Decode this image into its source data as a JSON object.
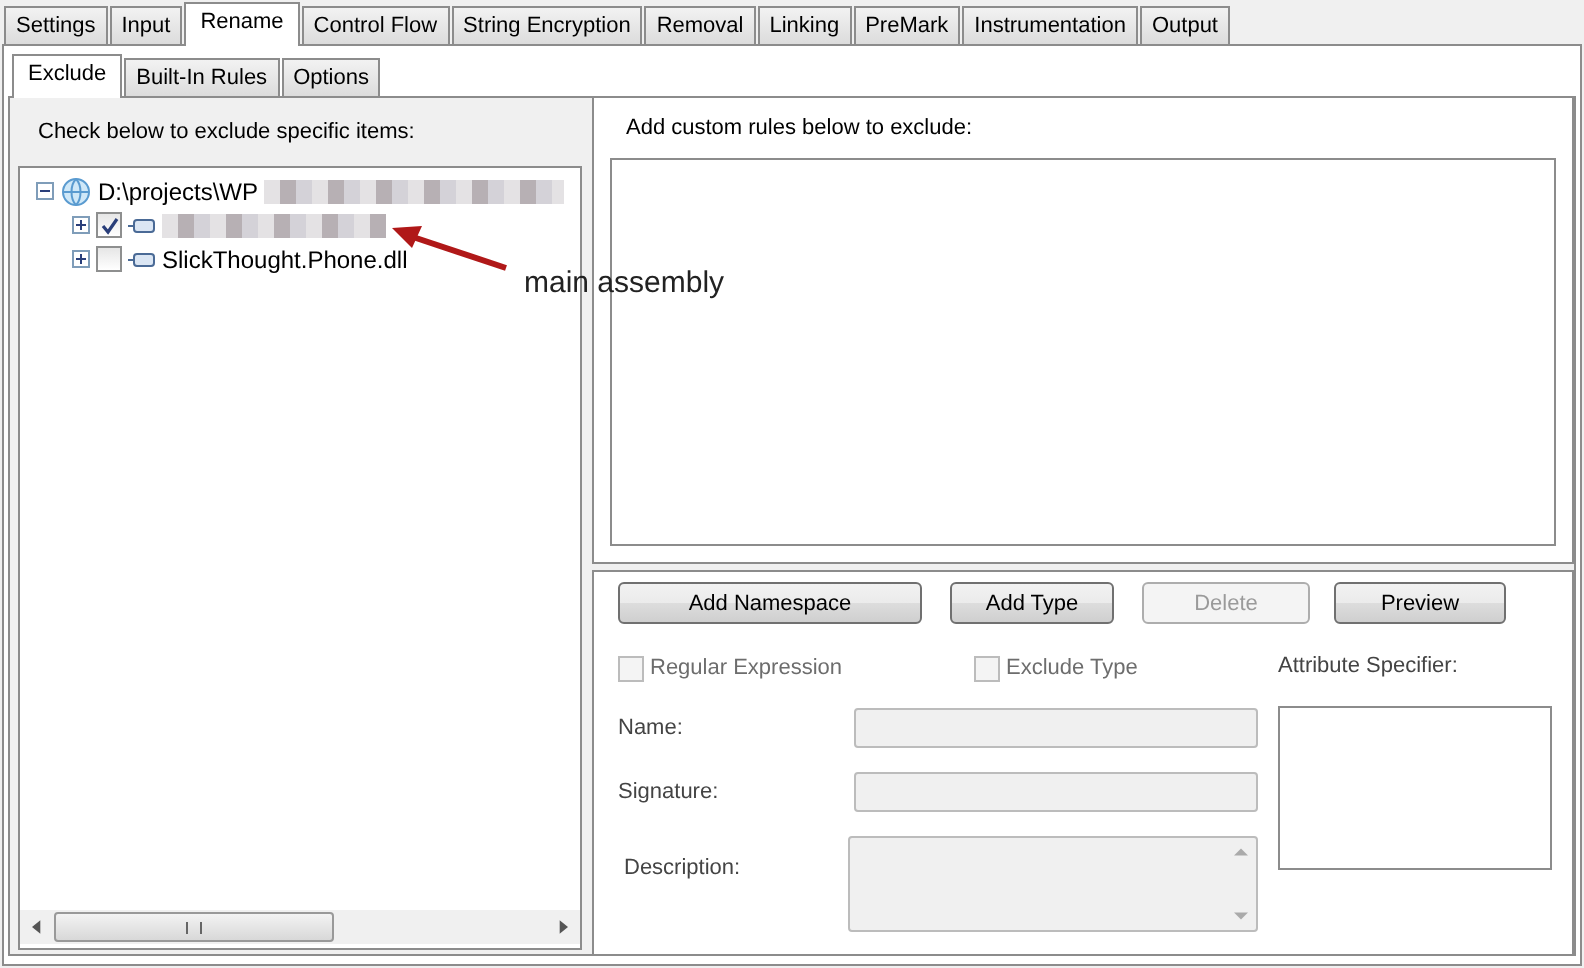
{
  "tabs": [
    {
      "label": "Settings",
      "selected": false
    },
    {
      "label": "Input",
      "selected": false
    },
    {
      "label": "Rename",
      "selected": true
    },
    {
      "label": "Control Flow",
      "selected": false
    },
    {
      "label": "String Encryption",
      "selected": false
    },
    {
      "label": "Removal",
      "selected": false
    },
    {
      "label": "Linking",
      "selected": false
    },
    {
      "label": "PreMark",
      "selected": false
    },
    {
      "label": "Instrumentation",
      "selected": false
    },
    {
      "label": "Output",
      "selected": false
    }
  ],
  "subtabs": [
    {
      "label": "Exclude",
      "selected": true
    },
    {
      "label": "Built-In Rules",
      "selected": false
    },
    {
      "label": "Options",
      "selected": false
    }
  ],
  "exclude_panel": {
    "heading": "Check below to exclude specific items:",
    "tree": [
      {
        "label": "D:\\projects\\WP",
        "redacted": true,
        "expanded": true,
        "children": [
          {
            "redacted": true,
            "checked": true,
            "expanded": false
          },
          {
            "label": "SlickThought.Phone.dll",
            "redacted": false,
            "checked": false,
            "expanded": false
          }
        ]
      }
    ]
  },
  "annotation": {
    "text": "main assembly"
  },
  "custom_rules": {
    "heading": "Add custom rules below to exclude:"
  },
  "buttons": [
    {
      "label": "Add Namespace",
      "disabled": false
    },
    {
      "label": "Add Type",
      "disabled": false
    },
    {
      "label": "Delete",
      "disabled": true
    },
    {
      "label": "Preview",
      "disabled": false
    }
  ],
  "options": [
    {
      "label": "Regular Expression",
      "checked": false,
      "disabled": true
    },
    {
      "label": "Exclude Type",
      "checked": false,
      "disabled": true
    }
  ],
  "attribute_label": "Attribute Specifier:",
  "fields": [
    {
      "label": "Name:",
      "kind": "line",
      "disabled": true
    },
    {
      "label": "Signature:",
      "kind": "line",
      "disabled": true
    },
    {
      "label": "Description:",
      "kind": "multiline",
      "disabled": true
    }
  ]
}
